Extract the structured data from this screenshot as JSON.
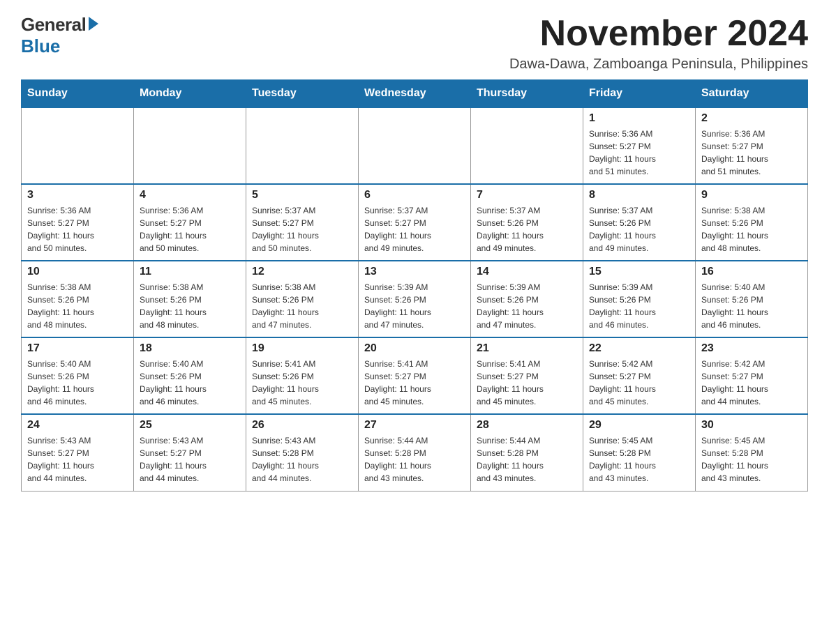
{
  "header": {
    "logo_general": "General",
    "logo_blue": "Blue",
    "month_title": "November 2024",
    "location": "Dawa-Dawa, Zamboanga Peninsula, Philippines"
  },
  "weekdays": [
    "Sunday",
    "Monday",
    "Tuesday",
    "Wednesday",
    "Thursday",
    "Friday",
    "Saturday"
  ],
  "weeks": [
    [
      {
        "day": "",
        "info": ""
      },
      {
        "day": "",
        "info": ""
      },
      {
        "day": "",
        "info": ""
      },
      {
        "day": "",
        "info": ""
      },
      {
        "day": "",
        "info": ""
      },
      {
        "day": "1",
        "info": "Sunrise: 5:36 AM\nSunset: 5:27 PM\nDaylight: 11 hours\nand 51 minutes."
      },
      {
        "day": "2",
        "info": "Sunrise: 5:36 AM\nSunset: 5:27 PM\nDaylight: 11 hours\nand 51 minutes."
      }
    ],
    [
      {
        "day": "3",
        "info": "Sunrise: 5:36 AM\nSunset: 5:27 PM\nDaylight: 11 hours\nand 50 minutes."
      },
      {
        "day": "4",
        "info": "Sunrise: 5:36 AM\nSunset: 5:27 PM\nDaylight: 11 hours\nand 50 minutes."
      },
      {
        "day": "5",
        "info": "Sunrise: 5:37 AM\nSunset: 5:27 PM\nDaylight: 11 hours\nand 50 minutes."
      },
      {
        "day": "6",
        "info": "Sunrise: 5:37 AM\nSunset: 5:27 PM\nDaylight: 11 hours\nand 49 minutes."
      },
      {
        "day": "7",
        "info": "Sunrise: 5:37 AM\nSunset: 5:26 PM\nDaylight: 11 hours\nand 49 minutes."
      },
      {
        "day": "8",
        "info": "Sunrise: 5:37 AM\nSunset: 5:26 PM\nDaylight: 11 hours\nand 49 minutes."
      },
      {
        "day": "9",
        "info": "Sunrise: 5:38 AM\nSunset: 5:26 PM\nDaylight: 11 hours\nand 48 minutes."
      }
    ],
    [
      {
        "day": "10",
        "info": "Sunrise: 5:38 AM\nSunset: 5:26 PM\nDaylight: 11 hours\nand 48 minutes."
      },
      {
        "day": "11",
        "info": "Sunrise: 5:38 AM\nSunset: 5:26 PM\nDaylight: 11 hours\nand 48 minutes."
      },
      {
        "day": "12",
        "info": "Sunrise: 5:38 AM\nSunset: 5:26 PM\nDaylight: 11 hours\nand 47 minutes."
      },
      {
        "day": "13",
        "info": "Sunrise: 5:39 AM\nSunset: 5:26 PM\nDaylight: 11 hours\nand 47 minutes."
      },
      {
        "day": "14",
        "info": "Sunrise: 5:39 AM\nSunset: 5:26 PM\nDaylight: 11 hours\nand 47 minutes."
      },
      {
        "day": "15",
        "info": "Sunrise: 5:39 AM\nSunset: 5:26 PM\nDaylight: 11 hours\nand 46 minutes."
      },
      {
        "day": "16",
        "info": "Sunrise: 5:40 AM\nSunset: 5:26 PM\nDaylight: 11 hours\nand 46 minutes."
      }
    ],
    [
      {
        "day": "17",
        "info": "Sunrise: 5:40 AM\nSunset: 5:26 PM\nDaylight: 11 hours\nand 46 minutes."
      },
      {
        "day": "18",
        "info": "Sunrise: 5:40 AM\nSunset: 5:26 PM\nDaylight: 11 hours\nand 46 minutes."
      },
      {
        "day": "19",
        "info": "Sunrise: 5:41 AM\nSunset: 5:26 PM\nDaylight: 11 hours\nand 45 minutes."
      },
      {
        "day": "20",
        "info": "Sunrise: 5:41 AM\nSunset: 5:27 PM\nDaylight: 11 hours\nand 45 minutes."
      },
      {
        "day": "21",
        "info": "Sunrise: 5:41 AM\nSunset: 5:27 PM\nDaylight: 11 hours\nand 45 minutes."
      },
      {
        "day": "22",
        "info": "Sunrise: 5:42 AM\nSunset: 5:27 PM\nDaylight: 11 hours\nand 45 minutes."
      },
      {
        "day": "23",
        "info": "Sunrise: 5:42 AM\nSunset: 5:27 PM\nDaylight: 11 hours\nand 44 minutes."
      }
    ],
    [
      {
        "day": "24",
        "info": "Sunrise: 5:43 AM\nSunset: 5:27 PM\nDaylight: 11 hours\nand 44 minutes."
      },
      {
        "day": "25",
        "info": "Sunrise: 5:43 AM\nSunset: 5:27 PM\nDaylight: 11 hours\nand 44 minutes."
      },
      {
        "day": "26",
        "info": "Sunrise: 5:43 AM\nSunset: 5:28 PM\nDaylight: 11 hours\nand 44 minutes."
      },
      {
        "day": "27",
        "info": "Sunrise: 5:44 AM\nSunset: 5:28 PM\nDaylight: 11 hours\nand 43 minutes."
      },
      {
        "day": "28",
        "info": "Sunrise: 5:44 AM\nSunset: 5:28 PM\nDaylight: 11 hours\nand 43 minutes."
      },
      {
        "day": "29",
        "info": "Sunrise: 5:45 AM\nSunset: 5:28 PM\nDaylight: 11 hours\nand 43 minutes."
      },
      {
        "day": "30",
        "info": "Sunrise: 5:45 AM\nSunset: 5:28 PM\nDaylight: 11 hours\nand 43 minutes."
      }
    ]
  ]
}
